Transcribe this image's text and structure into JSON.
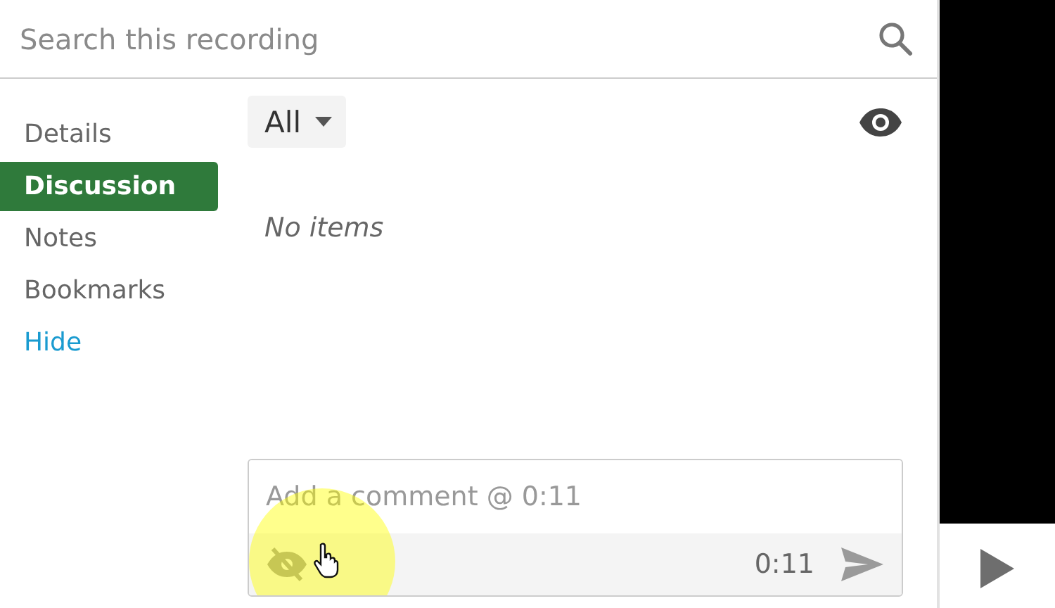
{
  "search": {
    "placeholder": "Search this recording"
  },
  "sidebar": {
    "items": [
      {
        "label": "Details",
        "kind": "tab",
        "selected": false
      },
      {
        "label": "Discussion",
        "kind": "tab",
        "selected": true
      },
      {
        "label": "Notes",
        "kind": "tab",
        "selected": false
      },
      {
        "label": "Bookmarks",
        "kind": "tab",
        "selected": false
      },
      {
        "label": "Hide",
        "kind": "link",
        "selected": false
      }
    ]
  },
  "filter": {
    "value": "All"
  },
  "empty_message": "No items",
  "composer": {
    "placeholder": "Add a comment @ 0:11",
    "time": "0:11"
  }
}
